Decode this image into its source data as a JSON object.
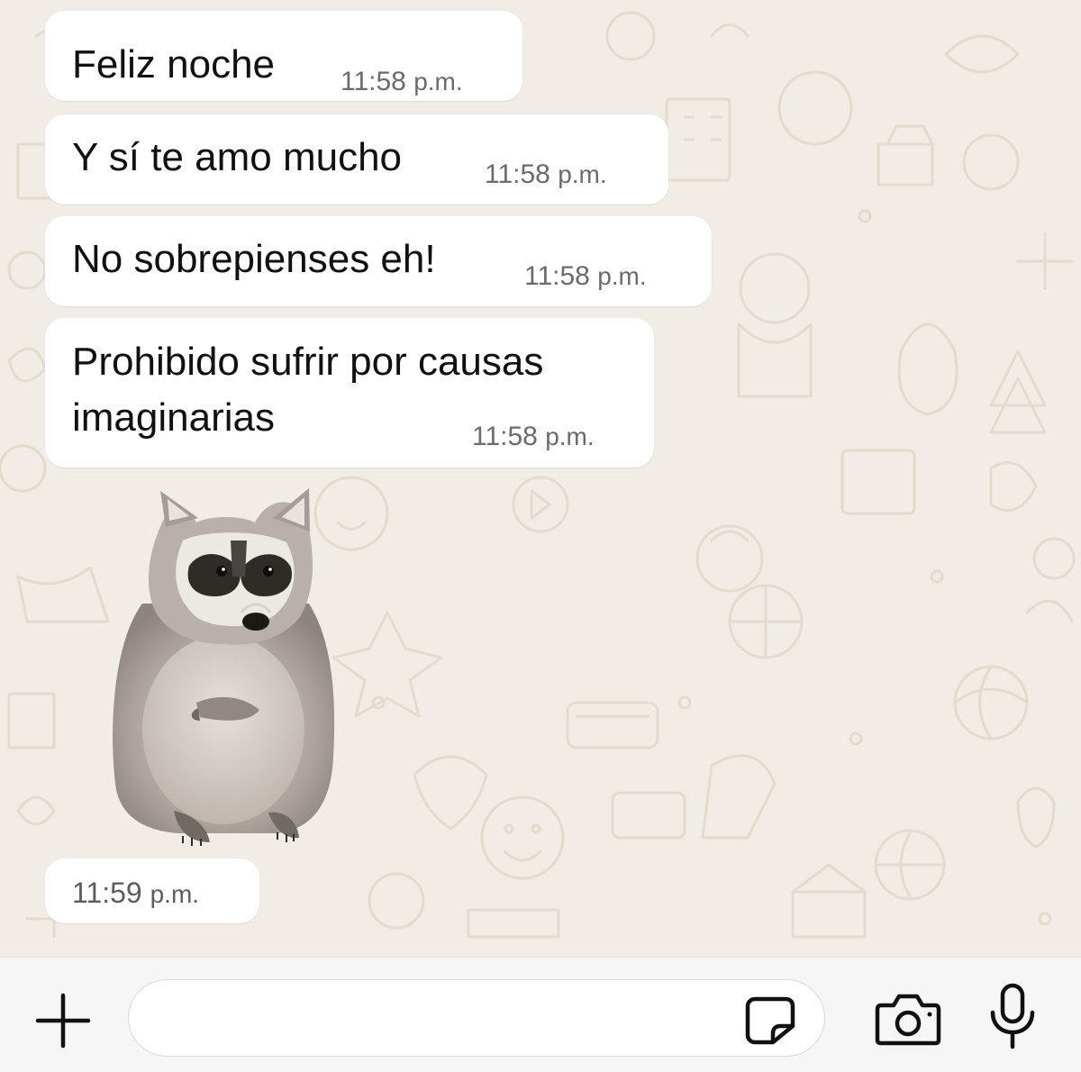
{
  "messages": [
    {
      "text": "Feliz noche",
      "time": "11:58",
      "period": "p.m."
    },
    {
      "text": "Y sí te amo mucho",
      "time": "11:58",
      "period": "p.m."
    },
    {
      "text": "No sobrepienses eh!",
      "time": "11:58",
      "period": "p.m."
    },
    {
      "text": "Prohibido sufrir por causas imaginarias",
      "time": "11:58",
      "period": "p.m."
    }
  ],
  "sticker": {
    "icon": "raccoon-sticker",
    "time": "11:59",
    "period": "p.m."
  },
  "input_bar": {
    "placeholder": "",
    "icons": [
      "plus-icon",
      "sticker-icon",
      "camera-icon",
      "microphone-icon"
    ]
  },
  "colors": {
    "chat_background": "#f1ece5",
    "bubble": "#ffffff",
    "text": "#111111",
    "timestamp": "#6b6b6b",
    "input_bar": "#f6f6f6"
  }
}
